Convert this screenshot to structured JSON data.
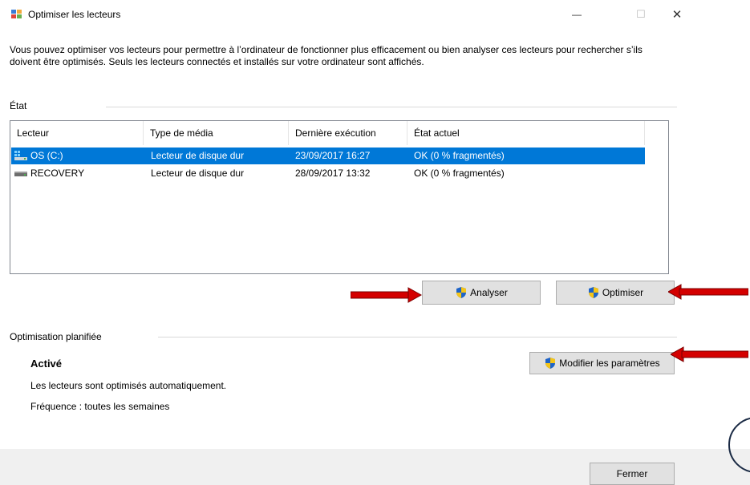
{
  "window": {
    "title": "Optimiser les lecteurs",
    "minimize_glyph": "—",
    "maximize_glyph": "☐",
    "close_glyph": "✕"
  },
  "description": "Vous pouvez optimiser vos lecteurs pour permettre à l’ordinateur de fonctionner plus efficacement ou bien analyser ces lecteurs pour rechercher s’ils doivent être optimisés. Seuls les lecteurs connectés et installés sur votre ordinateur sont affichés.",
  "status_section": {
    "label": "État"
  },
  "drives_table": {
    "headers": [
      "Lecteur",
      "Type de média",
      "Dernière exécution",
      "État actuel"
    ],
    "rows": [
      {
        "icon": "windows-drive-icon",
        "drive": "OS (C:)",
        "media": "Lecteur de disque dur",
        "last_run": "23/09/2017 16:27",
        "status": "OK (0 % fragmentés)",
        "selected": true
      },
      {
        "icon": "hard-drive-icon",
        "drive": "RECOVERY",
        "media": "Lecteur de disque dur",
        "last_run": "28/09/2017 13:32",
        "status": "OK (0 % fragmentés)",
        "selected": false
      }
    ]
  },
  "buttons": {
    "analyze": "Analyser",
    "optimize": "Optimiser",
    "change_settings": "Modifier les paramètres",
    "close": "Fermer"
  },
  "scheduled": {
    "label": "Optimisation planifiée",
    "state": "Activé",
    "auto_text": "Les lecteurs sont optimisés automatiquement.",
    "frequency": "Fréquence : toutes les semaines"
  },
  "colors": {
    "selection": "#0078d7",
    "annotation_arrow": "#d40000",
    "button_bg": "#e1e1e1"
  },
  "icons": [
    "defrag-app-icon",
    "uac-shield-icon",
    "red-arrow-annotation"
  ]
}
